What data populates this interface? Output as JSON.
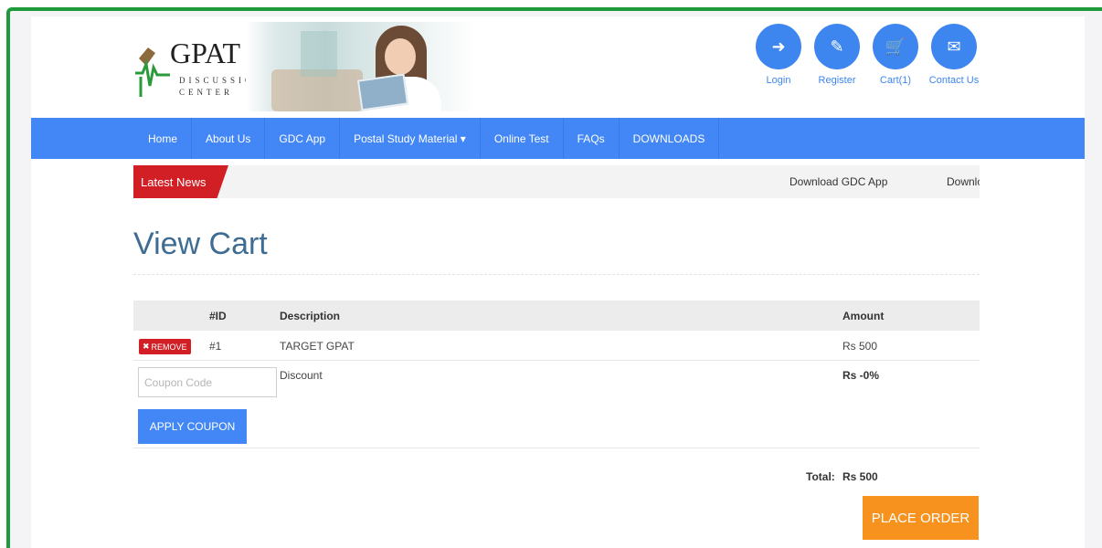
{
  "logo": {
    "title": "GPAT",
    "subtitle": "DISCUSSION CENTER"
  },
  "top_links": [
    {
      "label": "Login",
      "icon": "login-icon",
      "glyph": "➜"
    },
    {
      "label": "Register",
      "icon": "edit-icon",
      "glyph": "✎"
    },
    {
      "label": "Cart(1)",
      "icon": "cart-icon",
      "glyph": "🛒"
    },
    {
      "label": "Contact Us",
      "icon": "envelope-icon",
      "glyph": "✉"
    }
  ],
  "nav": [
    {
      "label": "Home"
    },
    {
      "label": "About Us"
    },
    {
      "label": "GDC App"
    },
    {
      "label": "Postal Study Material ▾"
    },
    {
      "label": "Online Test"
    },
    {
      "label": "FAQs"
    },
    {
      "label": "DOWNLOADS"
    }
  ],
  "news": {
    "tag": "Latest News",
    "items": [
      "Download GDC App",
      "Downlc"
    ]
  },
  "cart": {
    "title": "View Cart",
    "headers": {
      "id": "#ID",
      "description": "Description",
      "amount": "Amount"
    },
    "item": {
      "remove_label": "REMOVE",
      "id": "#1",
      "description": "TARGET GPAT",
      "amount": "Rs 500"
    },
    "coupon_placeholder": "Coupon Code",
    "discount_label": "Discount",
    "discount_value": "Rs -0%",
    "apply_label": "APPLY COUPON",
    "total_label": "Total:",
    "total_value": "Rs 500",
    "place_order_label": "PLACE ORDER"
  },
  "colors": {
    "primary": "#4287f5",
    "news_red": "#d11f25",
    "order_orange": "#f7921e",
    "title_blue": "#3f6c93",
    "frame_green": "#1e9a3c"
  }
}
